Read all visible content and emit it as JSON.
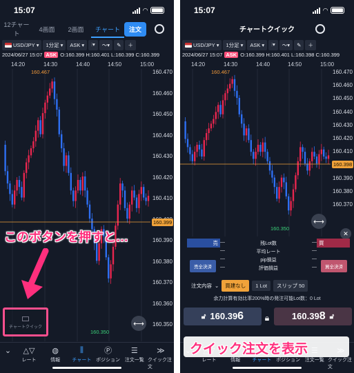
{
  "left": {
    "status_time": "15:07",
    "tabs": [
      "12チャート",
      "4画面",
      "2画面",
      "チャート"
    ],
    "order_button": "注文",
    "toolbar": {
      "symbol": "USD/JPY",
      "timeframe": "1分足",
      "price_type": "ASK"
    },
    "info": {
      "datetime": "2024/06/27 15:07",
      "ask_label": "ASK",
      "ohlc": "O:160.399 H:160.401 L:160.399 C:160.399"
    },
    "time_labels": [
      "14:20",
      "14:30",
      "14:40",
      "14:50",
      "15:00"
    ],
    "price_labels": [
      "160.470",
      "160.460",
      "160.450",
      "160.440",
      "160.430",
      "160.420",
      "160.410",
      "160.400",
      "160.390",
      "160.380",
      "160.370",
      "160.360",
      "160.350"
    ],
    "current_price": "160.399",
    "high_label": "160.467",
    "low_label": "160.350",
    "quick_button_label": "チャートクイック",
    "caption": "このボタンを押すと…",
    "nav": [
      "レート",
      "情報",
      "チャート",
      "ポジション",
      "注文一覧",
      "クイック注文"
    ]
  },
  "right": {
    "status_time": "15:07",
    "title": "チャートクイック",
    "toolbar": {
      "symbol": "USD/JPY",
      "timeframe": "1分足",
      "price_type": "ASK"
    },
    "info": {
      "datetime": "2024/06/27 15:07",
      "ask_label": "ASK",
      "ohlc": "O:160.399 H:160.401 L:160.398 C:160.399"
    },
    "time_labels": [
      "14:20",
      "14:30",
      "14:40",
      "14:50",
      "15:00"
    ],
    "price_labels": [
      "160.470",
      "160.460",
      "160.450",
      "160.440",
      "160.430",
      "160.420",
      "160.410",
      "160.400",
      "160.390",
      "160.380",
      "160.370"
    ],
    "current_price": "160.398",
    "high_label": "160.467",
    "low_label": "160.350",
    "panel": {
      "sell_label": "売",
      "buy_label": "買",
      "rows": [
        "残Lot数",
        "平均レート",
        "pip損益",
        "評価損益"
      ],
      "dash": "—",
      "sell_settle": "売全決済",
      "buy_settle": "買全決済",
      "order_label": "注文内容",
      "slip_toggle": "買建なし",
      "lot": "1 Lot",
      "slip": "スリップ 50",
      "margin_text": "余力計算有効比率200%時の発注可能Lot数：0 Lot",
      "sell_price_main": "160.39",
      "sell_price_small": "6",
      "buy_price_main": "160.39",
      "buy_price_small": "8"
    },
    "caption": "クイック注文を表示",
    "nav": [
      "レート",
      "情報",
      "チャート",
      "ポジション",
      "注文一覧",
      "クイック注文"
    ]
  },
  "colors": {
    "up": "#e8264f",
    "down": "#2e6ff2",
    "accent": "#3ea0ff",
    "highlight": "#ff2f7d"
  }
}
